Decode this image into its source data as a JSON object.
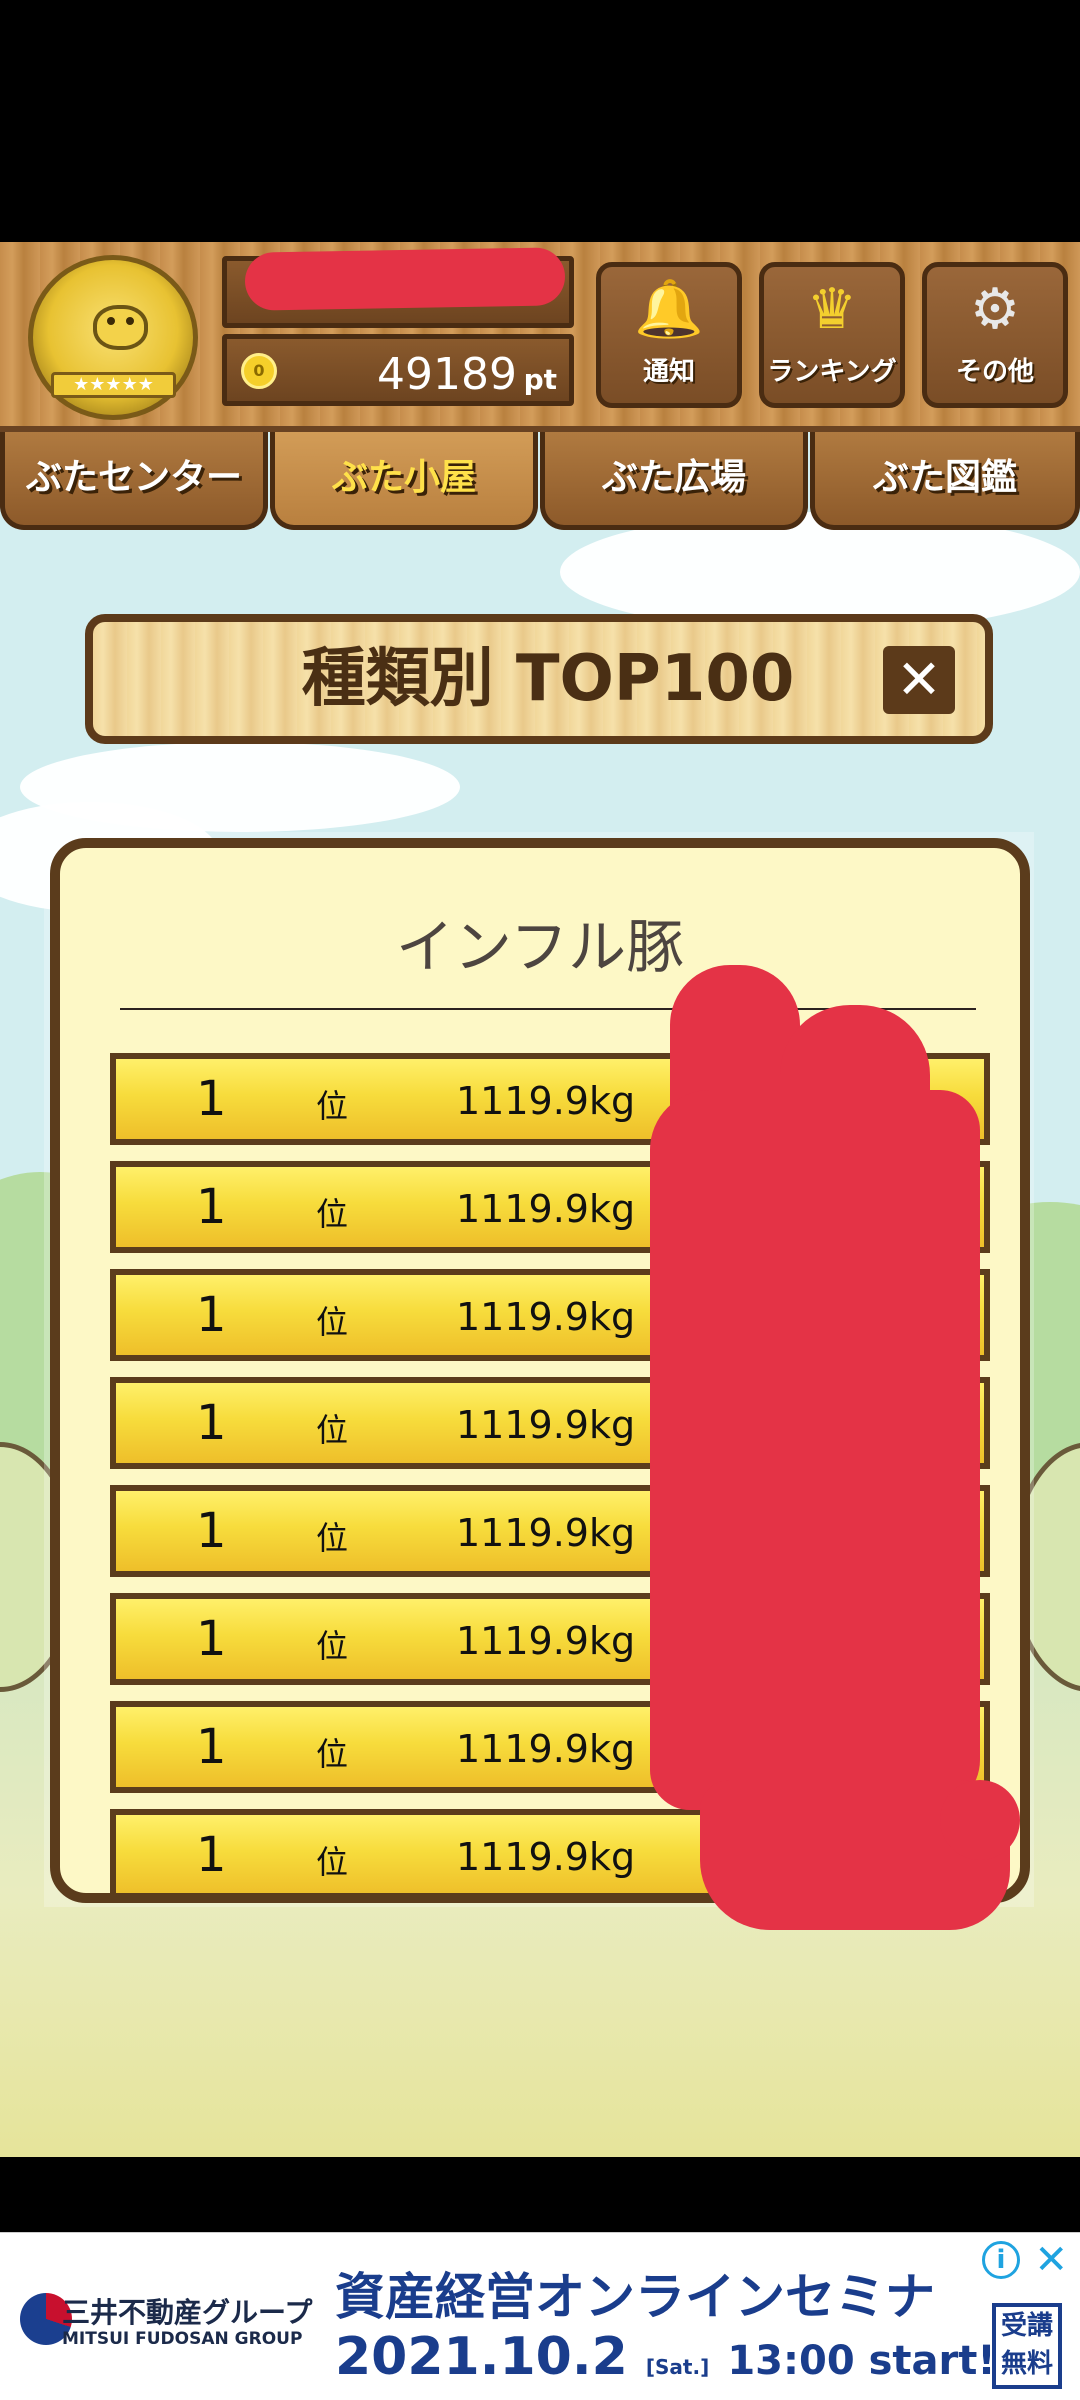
{
  "header": {
    "points_value": "49189",
    "points_unit": "pt",
    "coin_glyph": "0",
    "badge_stars": "★★★★★",
    "buttons": [
      {
        "label": "通知",
        "icon": "bell-icon",
        "glyph": "🔔"
      },
      {
        "label": "ランキング",
        "icon": "crown-icon",
        "glyph": "♛"
      },
      {
        "label": "その他",
        "icon": "gear-icon",
        "glyph": "⚙"
      }
    ]
  },
  "nav": {
    "tabs": [
      {
        "label": "ぶたセンター",
        "active": false
      },
      {
        "label": "ぶた小屋",
        "active": true
      },
      {
        "label": "ぶた広場",
        "active": false
      },
      {
        "label": "ぶた図鑑",
        "active": false
      }
    ]
  },
  "ranking": {
    "title": "種類別 TOP100",
    "close_glyph": "✕",
    "category": "インフル豚",
    "rank_unit": "位",
    "rows": [
      {
        "rank": "1",
        "weight": "1119.9kg"
      },
      {
        "rank": "1",
        "weight": "1119.9kg"
      },
      {
        "rank": "1",
        "weight": "1119.9kg"
      },
      {
        "rank": "1",
        "weight": "1119.9kg"
      },
      {
        "rank": "1",
        "weight": "1119.9kg"
      },
      {
        "rank": "1",
        "weight": "1119.9kg"
      },
      {
        "rank": "1",
        "weight": "1119.9kg"
      },
      {
        "rank": "1",
        "weight": "1119.9kg"
      }
    ]
  },
  "ad": {
    "company": "三井不動産グループ",
    "company_en": "MITSUI FUDOSAN GROUP",
    "headline": "資産経営オンラインセミナ",
    "date": "2021.10.2",
    "day": "[Sat.]",
    "time": "13:00 start!",
    "badge_line1": "受講",
    "badge_line2": "無料",
    "info_glyph": "i",
    "close_glyph": "✕"
  },
  "colors": {
    "wood": "#c68d4c",
    "wood_dark": "#4a2c12",
    "row_gold": "#f7dc3c",
    "panel_cream": "#fdf8c6",
    "redaction": "#e43346",
    "ad_blue": "#1a3d8c"
  }
}
